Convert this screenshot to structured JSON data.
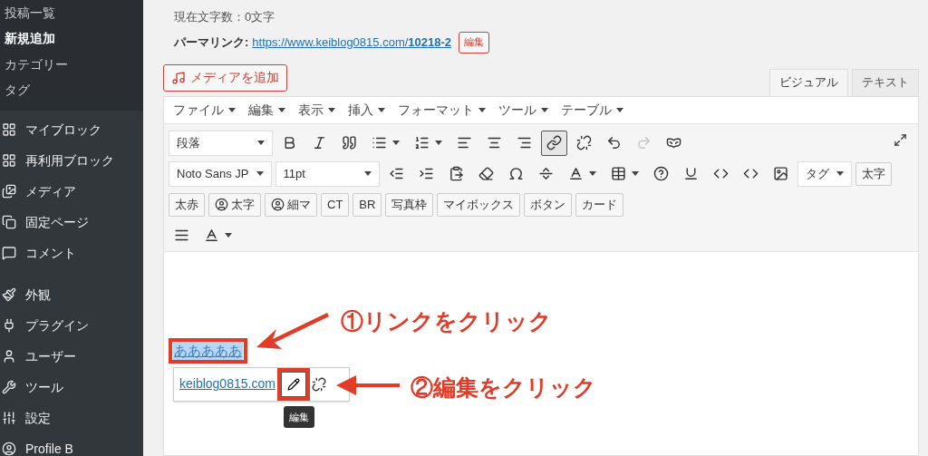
{
  "sidebar": {
    "submenu": [
      {
        "label": "投稿一覧",
        "selected": false
      },
      {
        "label": "新規追加",
        "selected": true
      },
      {
        "label": "カテゴリー",
        "selected": false
      },
      {
        "label": "タグ",
        "selected": false
      }
    ],
    "menu": [
      {
        "label": "マイブロック"
      },
      {
        "label": "再利用ブロック"
      },
      {
        "label": "メディア"
      },
      {
        "label": "固定ページ"
      },
      {
        "label": "コメント"
      },
      {
        "label": "外観"
      },
      {
        "label": "プラグイン"
      },
      {
        "label": "ユーザー"
      },
      {
        "label": "ツール"
      },
      {
        "label": "設定"
      },
      {
        "label": "Profile B"
      }
    ]
  },
  "char_count": "現在文字数：0文字",
  "permalink": {
    "label": "パーマリンク:",
    "url": "https://www.keiblog0815.com/**10218-2**",
    "edit_button": "編集"
  },
  "add_media_button": "メディアを追加",
  "editor_tabs": [
    {
      "label": "ビジュアル",
      "selected": true
    },
    {
      "label": "テキスト",
      "selected": false
    }
  ],
  "menubar": [
    "ファイル",
    "編集",
    "表示",
    "挿入",
    "フォーマット",
    "ツール",
    "テーブル"
  ],
  "toolbar_rows": [
    [
      {
        "kind": "select",
        "label": "段落",
        "wide": true
      },
      {
        "kind": "icon"
      },
      {
        "kind": "icon"
      },
      {
        "kind": "icon"
      },
      {
        "kind": "icon-dropdown"
      },
      {
        "kind": "icon-dropdown"
      },
      {
        "kind": "icon"
      },
      {
        "kind": "icon"
      },
      {
        "kind": "icon"
      },
      {
        "kind": "icon",
        "pressed": true
      },
      {
        "kind": "icon"
      },
      {
        "kind": "icon"
      },
      {
        "kind": "icon",
        "disabled": true
      },
      {
        "kind": "icon"
      }
    ],
    [
      {
        "kind": "select",
        "label": "Noto Sans JP",
        "wide": false
      },
      {
        "kind": "select",
        "label": "11pt",
        "wide": true
      },
      {
        "kind": "icon"
      },
      {
        "kind": "icon"
      },
      {
        "kind": "icon"
      },
      {
        "kind": "icon"
      },
      {
        "kind": "icon"
      },
      {
        "kind": "icon"
      },
      {
        "kind": "icon-dropdown"
      },
      {
        "kind": "icon-dropdown"
      },
      {
        "kind": "icon"
      },
      {
        "kind": "icon"
      },
      {
        "kind": "icon"
      },
      {
        "kind": "icon"
      },
      {
        "kind": "icon"
      },
      {
        "kind": "select",
        "label": "タグ",
        "wide": false
      },
      {
        "kind": "text",
        "label": "太字"
      }
    ],
    [
      {
        "kind": "text",
        "label": "太赤"
      },
      {
        "kind": "user-text",
        "label": "太字"
      },
      {
        "kind": "user-text",
        "label": "細マ"
      },
      {
        "kind": "text",
        "label": "CT"
      },
      {
        "kind": "text",
        "label": "BR"
      },
      {
        "kind": "text",
        "label": "写真枠"
      },
      {
        "kind": "text",
        "label": "マイボックス"
      },
      {
        "kind": "text",
        "label": "ボタン"
      },
      {
        "kind": "text",
        "label": "カード"
      }
    ],
    [
      {
        "kind": "icon"
      },
      {
        "kind": "icon-dropdown"
      }
    ]
  ],
  "content": {
    "linked_text": "あああああ",
    "link_popup": {
      "url": "keiblog0815.com"
    },
    "tooltip": "編集"
  },
  "annotations": [
    {
      "text": "①リンクをクリック"
    },
    {
      "text": "②編集をクリック"
    }
  ]
}
